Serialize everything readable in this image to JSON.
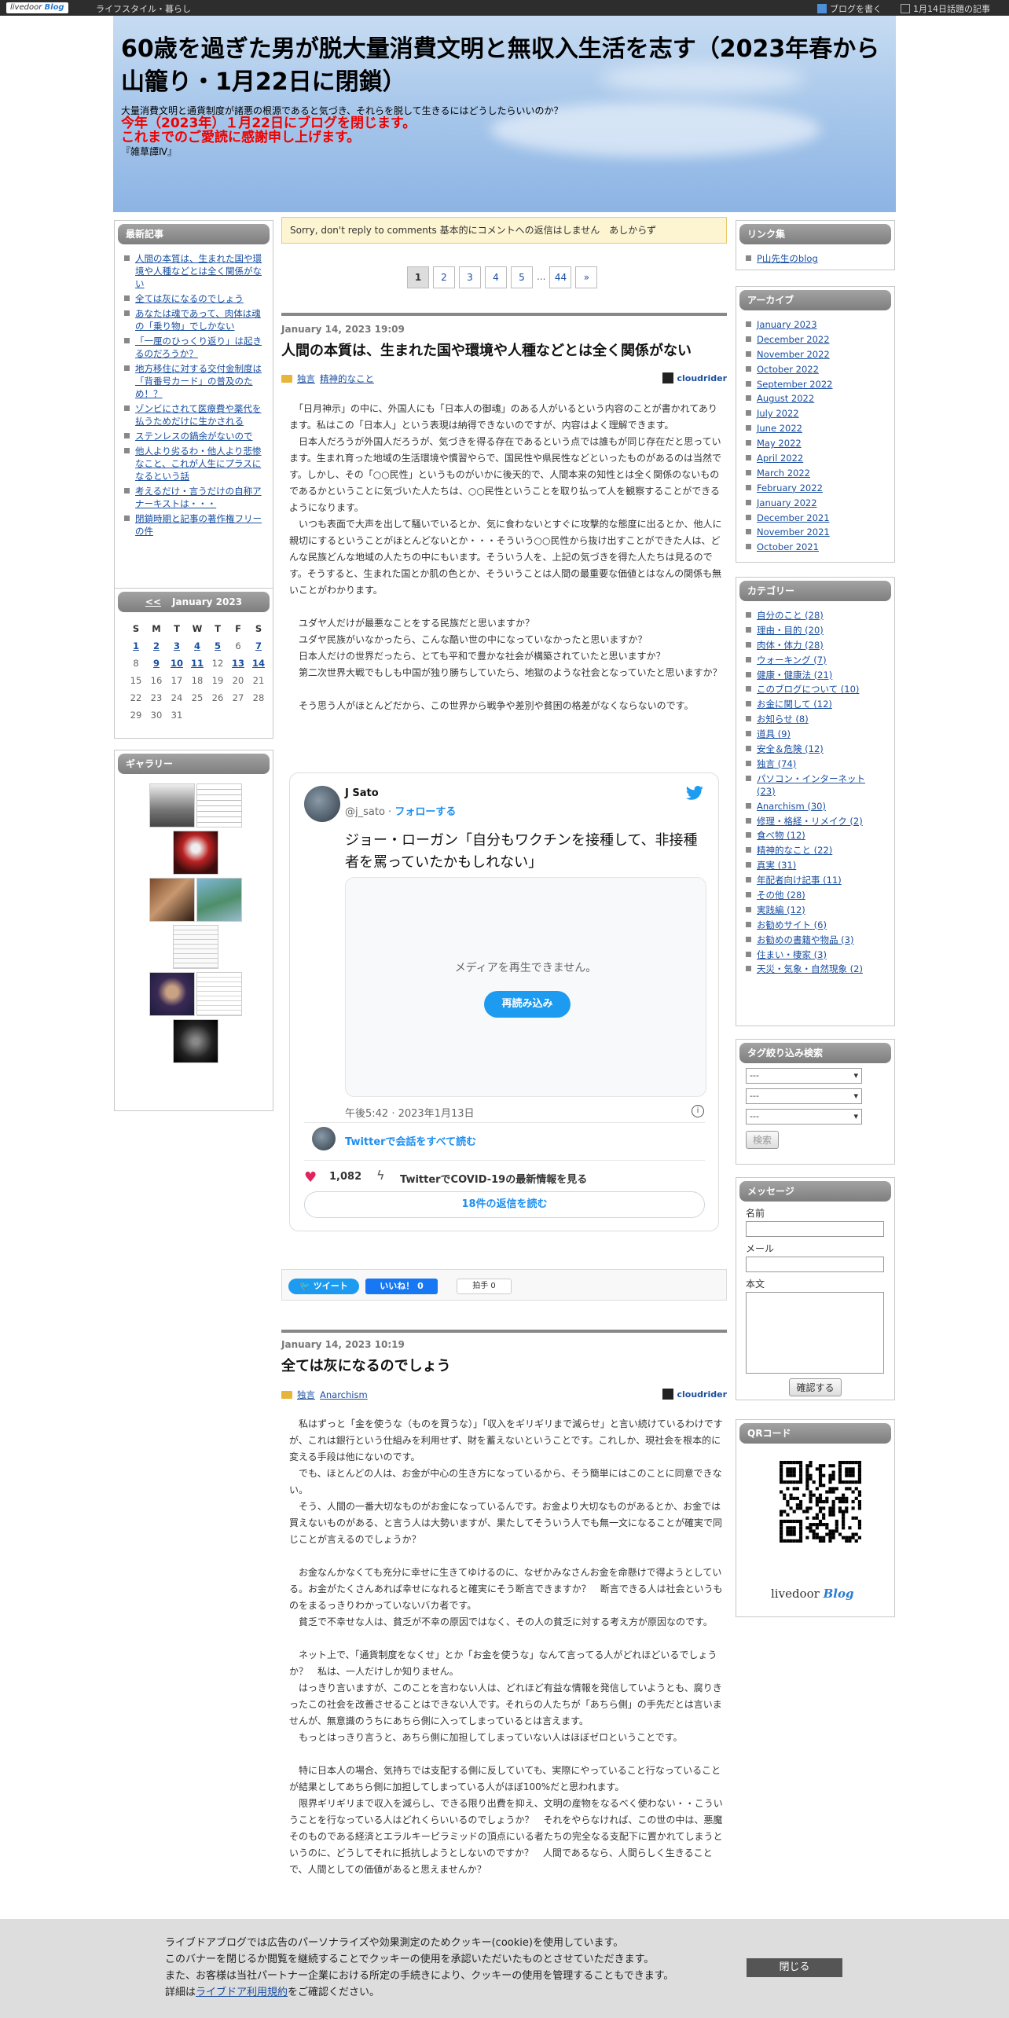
{
  "topbar": {
    "logo_text": "livedoor",
    "logo_blog": "Blog",
    "category": "ライフスタイル・暮らし",
    "write_blog": "ブログを書く",
    "topics": "1月14日話題の記事"
  },
  "header": {
    "title": "60歳を過ぎた男が脱大量消費文明と無収入生活を志す（2023年春から山籠り・1月22日に閉鎖）",
    "description": "大量消費文明と通貨制度が諸悪の根源であると気づき、それらを脱して生きるにはどうしたらいいのか？",
    "notice_line1": "今年（2023年）１月22日にブログを閉じます。",
    "notice_line2": "これまでのご愛読に感謝申し上げます。",
    "subtitle": "『雑草譚Ⅳ』"
  },
  "left": {
    "recent_title": "最新記事",
    "recent": [
      "人間の本質は、生まれた国や環境や人種などとは全く関係がない",
      "全ては灰になるのでしょう",
      "あなたは魂であって、肉体は魂の「乗り物」でしかない",
      "「一厘のひっくり返り」は起きるのだろうか？",
      "地方移住に対する交付金制度は「背番号カード」の普及のため！？",
      "ゾンビにされて医療費や薬代を払うためだけに生かされる",
      "ステンレスの鍋余がないので",
      "他人より劣るわ・他人より悲惨なこと、これが人生にプラスになるという話",
      "考えるだけ・言うだけの自称アナーキストは・・・",
      "閉鎖時期と記事の著作権フリーの件"
    ],
    "calendar": {
      "prev": "<<",
      "month": "January 2023",
      "weekdays": [
        "S",
        "M",
        "T",
        "W",
        "T",
        "F",
        "S"
      ],
      "rows": [
        [
          "1",
          "2",
          "3",
          "4",
          "5",
          "6",
          "7"
        ],
        [
          "8",
          "9",
          "10",
          "11",
          "12",
          "13",
          "14"
        ],
        [
          "15",
          "16",
          "17",
          "18",
          "19",
          "20",
          "21"
        ],
        [
          "22",
          "23",
          "24",
          "25",
          "26",
          "27",
          "28"
        ],
        [
          "29",
          "30",
          "31",
          "",
          "",
          "",
          ""
        ]
      ],
      "linked_days": [
        "1",
        "2",
        "3",
        "4",
        "5",
        "7",
        "9",
        "10",
        "11",
        "13",
        "14"
      ]
    },
    "gallery_title": "ギャラリー"
  },
  "main": {
    "notice": "Sorry, don't reply to comments 基本的にコメントへの返信はしません　あしからず",
    "pager": [
      "1",
      "2",
      "3",
      "4",
      "5",
      "...",
      "44",
      "»"
    ],
    "post1": {
      "date": "January 14, 2023 19:09",
      "title": "人間の本質は、生まれた国や環境や人種などとは全く関係がない",
      "tags": [
        "独言",
        "精神的なこと"
      ],
      "author": "cloudrider",
      "body": [
        "　「日月神示」の中に、外国人にも「日本人の御魂」のある人がいるという内容のことが書かれてあります。私はこの「日本人」という表現は納得できないのですが、内容はよく理解できます。",
        "　日本人だろうが外国人だろうが、気づきを得る存在であるという点では誰もが同じ存在だと思っています。生まれ育った地域の生活環境や慣習やらで、国民性や県民性などといったものがあるのは当然です。しかし、その「○○民性」というものがいかに後天的で、人間本来の知性とは全く関係のないものであるかということに気づいた人たちは、○○民性ということを取り払って人を観察することができるようになります。",
        "　いつも表面で大声を出して騒いでいるとか、気に食わないとすぐに攻撃的な態度に出るとか、他人に親切にするということがほとんどないとか・・・そういう○○民性から抜け出すことができた人は、どんな民族どんな地域の人たちの中にもいます。そういう人を、上記の気づきを得た人たちは見るのです。そうすると、生まれた国とか肌の色とか、そういうことは人間の最重要な価値とはなんの関係も無いことがわかります。",
        "",
        "　ユダヤ人だけが最悪なことをする民族だと思いますか？",
        "　ユダヤ民族がいなかったら、こんな酷い世の中になっていなかったと思いますか？",
        "　日本人だけの世界だったら、とても平和で豊かな社会が構築されていたと思いますか？",
        "　第二次世界大戦でもしも中国が独り勝ちしていたら、地獄のような社会となっていたと思いますか？",
        "",
        "　そう思う人がほとんどだから、この世界から戦争や差別や貧困の格差がなくならないのです。"
      ]
    },
    "tweet": {
      "name": "J Sato",
      "handle": "@j_sato",
      "follow": "フォローする",
      "text": "ジョー・ローガン「自分もワクチンを接種して、非接種者を罵っていたかもしれない」",
      "media_message": "メディアを再生できません。",
      "reload": "再読み込み",
      "time": "午後5:42 · 2023年1月13日",
      "conversation": "Twitterで会話をすべて読む",
      "likes": "1,082",
      "covid": "TwitterでCOVID-19の最新情報を見る",
      "replies": "18件の返信を読む"
    },
    "share": {
      "tweet": "ツイート",
      "like": "いいね！ 0",
      "clap": "拍手 0"
    },
    "post2": {
      "date": "January 14, 2023 10:19",
      "title": "全ては灰になるのでしょう",
      "tags": [
        "独言",
        "Anarchism"
      ],
      "author": "cloudrider",
      "body": [
        "　私はずっと「金を使うな（ものを買うな）」「収入をギリギリまで減らせ」と言い続けているわけですが、これは銀行という仕組みを利用せず、財を蓄えないということです。これしか、現社会を根本的に変える手段は他にないのです。",
        "　でも、ほとんどの人は、お金が中心の生き方になっているから、そう簡単にはこのことに同意できない。",
        "　そう、人間の一番大切なものがお金になっているんです。お金より大切なものがあるとか、お金では買えないものがある、と言う人は大勢いますが、果たしてそういう人でも無一文になることが確実で同じことが言えるのでしょうか？",
        "",
        "　お金なんかなくても充分に幸せに生きてゆけるのに、なぜかみなさんお金を命懸けで得ようとしている。お金がたくさんあれば幸せになれると確実にそう断言できますか？　断言できる人は社会というものをまるっきりわかっていないバカ者です。",
        "　貧乏で不幸せな人は、貧乏が不幸の原因ではなく、その人の貧乏に対する考え方が原因なのです。",
        "",
        "　ネット上で、「通貨制度をなくせ」とか「お金を使うな」なんて言ってる人がどれほどいるでしょうか？　私は、一人だけしか知りません。",
        "　はっきり言いますが、このことを言わない人は、どれほど有益な情報を発信していようとも、腐りきったこの社会を改善させることはできない人です。それらの人たちが「あちら側」の手先だとは言いませんが、無意識のうちにあちら側に入ってしまっているとは言えます。",
        "　もっとはっきり言うと、あちら側に加担してしまっていない人はほぼゼロということです。",
        "",
        "　特に日本人の場合、気持ちでは支配する側に反していても、実際にやっていること行なっていることが結果としてあちら側に加担してしまっている人がほぼ100%だと思われます。",
        "　限界ギリギリまで収入を減らし、できる限り出費を抑え、文明の産物をなるべく使わない・・こういうことを行なっている人はどれくらいいるのでしょうか？　それをやらなければ、この世の中は、悪魔そのものである経済とエラルキーピラミッドの頂点にいる者たちの完全なる支配下に置かれてしまうというのに、どうしてそれに抵抗しようとしないのですか？　人間であるなら、人間らしく生きることで、人間としての価値があると思えませんか？"
      ]
    }
  },
  "right": {
    "links_title": "リンク集",
    "links": [
      "P山先生のblog"
    ],
    "archive_title": "アーカイブ",
    "archives": [
      "January 2023",
      "December 2022",
      "November 2022",
      "October 2022",
      "September 2022",
      "August 2022",
      "July 2022",
      "June 2022",
      "May 2022",
      "April 2022",
      "March 2022",
      "February 2022",
      "January 2022",
      "December 2021",
      "November 2021",
      "October 2021"
    ],
    "category_title": "カテゴリー",
    "categories": [
      "自分のこと (28)",
      "理由・目的 (20)",
      "肉体・体力 (28)",
      "ウォーキング (7)",
      "健康・健康法 (21)",
      "このブログについて (10)",
      "お金に関して (12)",
      "お知らせ (8)",
      "道具 (9)",
      "安全＆危険 (12)",
      "独言 (74)",
      "パソコン・インターネット (23)",
      "Anarchism (30)",
      "修理・格経・リメイク (2)",
      "食べ物 (12)",
      "精神的なこと (22)",
      "真実 (31)",
      "年配者向け記事 (11)",
      "その他 (28)",
      "実践編 (12)",
      "お勧めサイト (6)",
      "お勧めの書籍や物品 (3)",
      "住まい・棲家 (3)",
      "天災・気象・自然現象 (2)"
    ],
    "tag_title": "タグ絞り込み検索",
    "tag_selects": [
      "---",
      "---",
      "---"
    ],
    "search": "検索",
    "message_title": "メッセージ",
    "name_label": "名前",
    "mail_label": "メール",
    "body_label": "本文",
    "confirm": "確認する",
    "qr_title": "QRコード",
    "footer_logo": "livedoor",
    "footer_logo_blog": "Blog"
  },
  "cookie": {
    "lines": [
      "ライブドアブログでは広告のパーソナライズや効果測定のためクッキー(cookie)を使用しています。",
      "このバナーを閉じるか閲覧を継続することでクッキーの使用を承認いただいたものとさせていただきます。",
      "また、お客様は当社パートナー企業における所定の手続きにより、クッキーの使用を管理することもできます。"
    ],
    "detail_prefix": "詳細は",
    "detail_link": "ライブドア利用規約",
    "detail_suffix": "をご確認ください。",
    "close": "閉じる"
  },
  "colors": {
    "accent_link": "#1a4fa0",
    "notice_red": "#e00000",
    "twitter_blue": "#1d9bf0"
  }
}
